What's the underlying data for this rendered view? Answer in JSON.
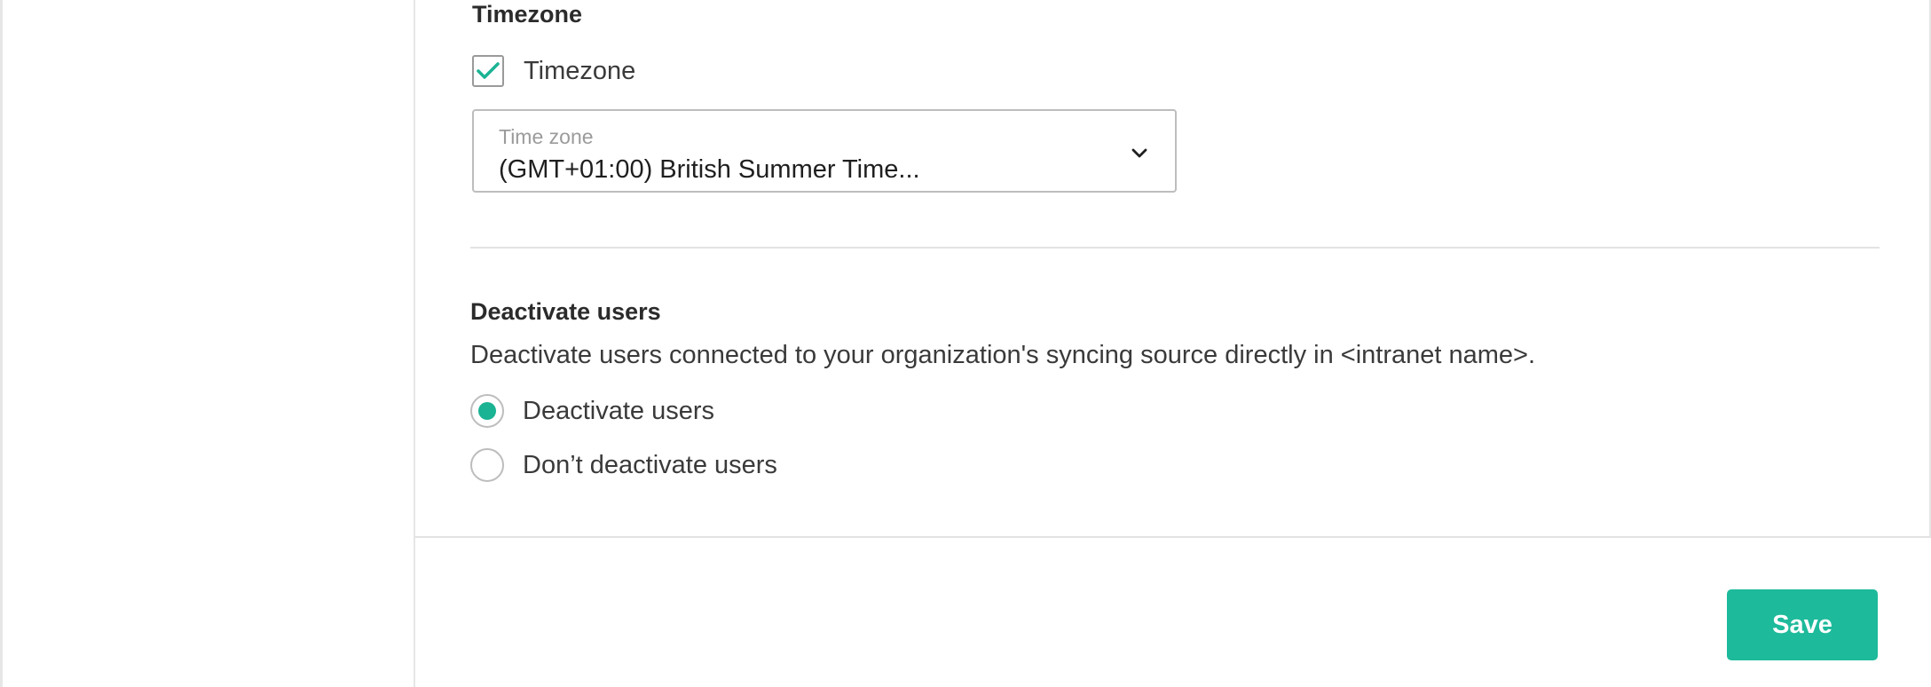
{
  "timezone_section": {
    "title": "Timezone",
    "checkbox_label": "Timezone",
    "checkbox_checked": true,
    "select_label": "Time zone",
    "select_value": "(GMT+01:00) British Summer Time..."
  },
  "deactivate_section": {
    "title": "Deactivate users",
    "description": "Deactivate users connected to your organization's syncing source directly in <intranet name>.",
    "options": [
      {
        "label": "Deactivate users",
        "selected": true
      },
      {
        "label": "Don’t deactivate users",
        "selected": false
      }
    ]
  },
  "footer": {
    "save_label": "Save"
  },
  "colors": {
    "accent": "#1dba9b",
    "border": "#bdbdbd",
    "divider": "#e3e3e3"
  }
}
